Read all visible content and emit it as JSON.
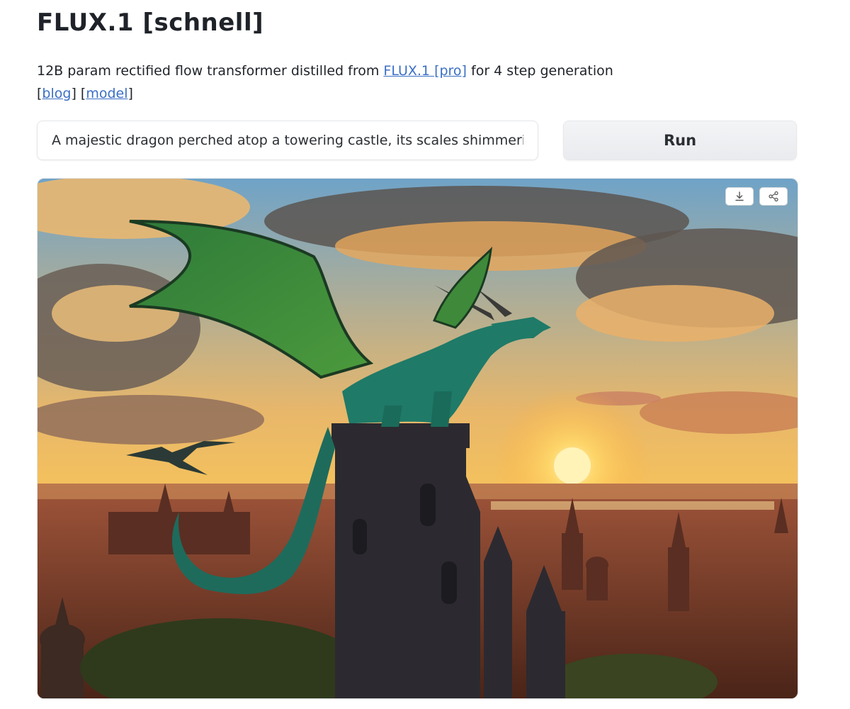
{
  "app": {
    "title": "FLUX.1 [schnell]"
  },
  "description": {
    "text_before_link": "12B param rectified flow transformer distilled from ",
    "pro_link": "FLUX.1 [pro]",
    "text_after_link": " for 4 step generation",
    "blog_link": "blog",
    "model_link": "model"
  },
  "prompt": {
    "value": "A majestic dragon perched atop a towering castle, its scales shimmering in the sunset light"
  },
  "run_button": {
    "label": "Run"
  },
  "result_image": {
    "icons": [
      "download-icon",
      "share-icon"
    ]
  },
  "colors": {
    "link": "#3b6fc4",
    "title": "#1f2329",
    "button_bg": "#eceef1"
  }
}
